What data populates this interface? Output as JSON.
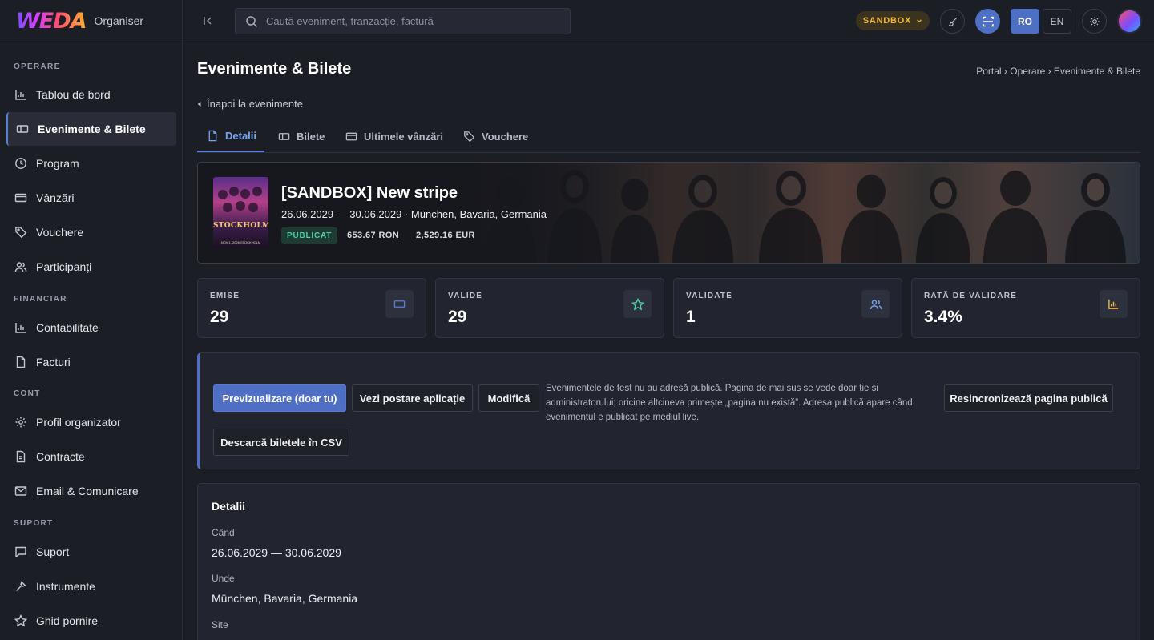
{
  "brand": {
    "logo": "WEDA",
    "subtitle": "Organiser"
  },
  "search": {
    "placeholder": "Caută eveniment, tranzacție, factură"
  },
  "topbar": {
    "env": "SANDBOX",
    "lang_ro": "RO",
    "lang_en": "EN"
  },
  "sidebar": {
    "sections": {
      "operare": "OPERARE",
      "financiar": "FINANCIAR",
      "cont": "CONT",
      "suport": "SUPORT"
    },
    "items": [
      {
        "label": "Tablou de bord",
        "icon": "bar-chart-icon"
      },
      {
        "label": "Evenimente & Bilete",
        "icon": "ticket-icon"
      },
      {
        "label": "Program",
        "icon": "clock-icon"
      },
      {
        "label": "Vânzări",
        "icon": "card-icon"
      },
      {
        "label": "Vouchere",
        "icon": "tag-icon"
      },
      {
        "label": "Participanți",
        "icon": "users-icon"
      },
      {
        "label": "Contabilitate",
        "icon": "bar-chart-icon"
      },
      {
        "label": "Facturi",
        "icon": "file-icon"
      },
      {
        "label": "Profil organizator",
        "icon": "gear-icon"
      },
      {
        "label": "Contracte",
        "icon": "document-icon"
      },
      {
        "label": "Email & Comunicare",
        "icon": "mail-icon"
      },
      {
        "label": "Suport",
        "icon": "chat-icon"
      },
      {
        "label": "Instrumente",
        "icon": "wrench-icon"
      },
      {
        "label": "Ghid pornire",
        "icon": "star-icon"
      }
    ]
  },
  "page": {
    "title": "Evenimente & Bilete",
    "breadcrumb": "Portal › Operare › Evenimente & Bilete",
    "back": "Înapoi la evenimente"
  },
  "tabs": [
    {
      "label": "Detalii"
    },
    {
      "label": "Bilete"
    },
    {
      "label": "Ultimele vânzări"
    },
    {
      "label": "Vouchere"
    }
  ],
  "event": {
    "title": "[SANDBOX] New stripe",
    "meta": "26.06.2029 — 30.06.2029 · München, Bavaria, Germania",
    "status": "PUBLICAT",
    "amount_ron": "653.67 RON",
    "amount_eur": "2,529.16 EUR",
    "poster_title": "STOCKHOLM",
    "poster_sub": "NOV 1, 2026 STOCKHOLM"
  },
  "stats": [
    {
      "label": "EMISE",
      "value": "29",
      "icon": "ticket-icon"
    },
    {
      "label": "VALIDE",
      "value": "29",
      "icon": "star-icon"
    },
    {
      "label": "VALIDATE",
      "value": "1",
      "icon": "users-icon"
    },
    {
      "label": "RATĂ DE VALIDARE",
      "value": "3.4%",
      "icon": "bar-chart-icon"
    }
  ],
  "actions": {
    "preview": "Previzualizare (doar tu)",
    "app_post": "Vezi postare aplicație",
    "edit": "Modifică",
    "note": "Evenimentele de test nu au adresă publică. Pagina de mai sus se vede doar ție și administratorului; oricine altcineva primește „pagina nu există”. Adresa publică apare când evenimentul e publicat pe mediul live.",
    "resync": "Resincronizează pagina publică",
    "csv": "Descarcă biletele în CSV"
  },
  "details": {
    "title": "Detalii",
    "when_label": "Când",
    "when_value": "26.06.2029 — 30.06.2029",
    "where_label": "Unde",
    "where_value": "München, Bavaria, Germania",
    "site_label": "Site"
  },
  "colors": {
    "accent": "#5b7fd6",
    "published": "#4fd1a5",
    "sandbox": "#f0b83c"
  }
}
